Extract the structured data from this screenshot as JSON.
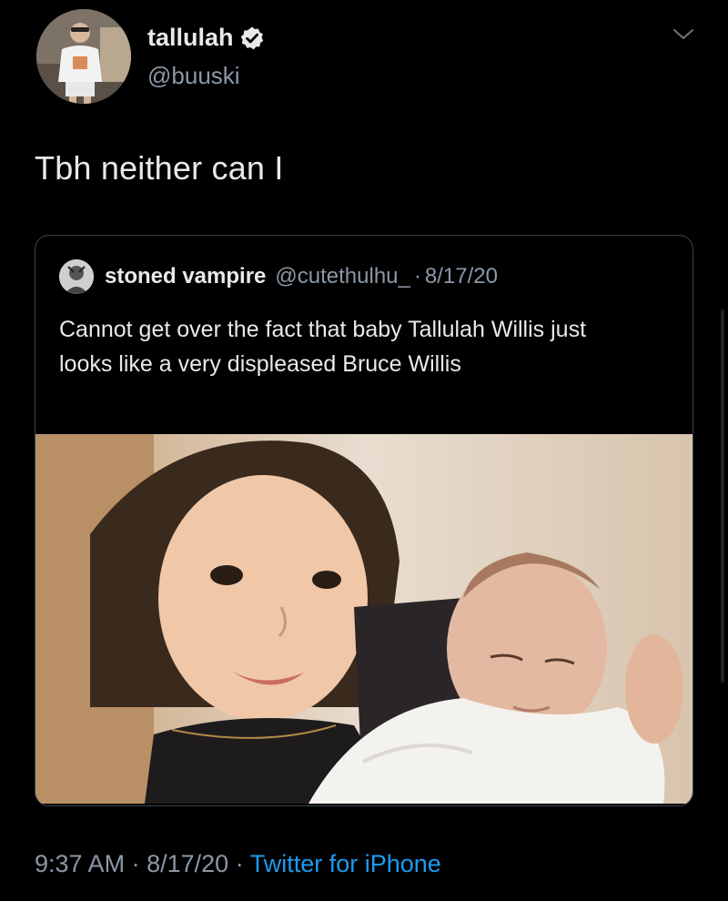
{
  "tweet": {
    "author": {
      "display_name": "tallulah",
      "handle": "@buuski",
      "verified_icon": "verified-badge-icon",
      "avatar_icon": "profile-photo"
    },
    "text": "Tbh neither can I",
    "timestamp": "9:37 AM",
    "date": "8/17/20",
    "separator": "·",
    "source": "Twitter for iPhone"
  },
  "quoted_tweet": {
    "display_name": "stoned vampire",
    "handle": "@cutethulhu_",
    "separator": "·",
    "date": "8/17/20",
    "text": "Cannot get over the fact that baby Tallulah Willis just looks like a very displeased Bruce Willis",
    "media_icon": "photo-of-child-holding-baby"
  },
  "colors": {
    "background": "#000000",
    "text_primary": "#e7e9ea",
    "text_secondary": "#8b98a5",
    "link": "#1d9bf0",
    "border": "#38444d"
  }
}
